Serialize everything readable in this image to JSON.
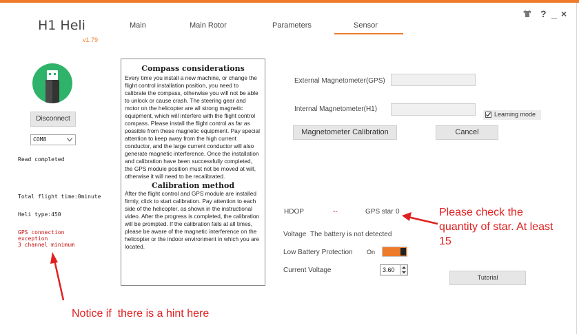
{
  "app": {
    "title": "H1 Heli",
    "version": "v1.79"
  },
  "tabs": [
    "Main",
    "Main Rotor",
    "Parameters",
    "Sensor"
  ],
  "window_controls": {
    "shirt": "shirt-icon",
    "help": "?",
    "minimize": "_",
    "close": "×"
  },
  "sidebar": {
    "disconnect_label": "Disconnect",
    "port_value": "COM8",
    "status_text": "Read completed",
    "flight_time": "Total flight time:0minute",
    "heli_type": "Heli type:450",
    "gps_error_line1": "GPS connection",
    "gps_error_line2": "exception",
    "gps_error_line3": "3 channel minimum"
  },
  "notes": {
    "compass_title": "Compass considerations",
    "compass_text": "Every time you install a new machine, or change the flight control installation position, you need to calibrate the compass, otherwise you will not be able to unlock or cause crash. The steering gear and motor on the helicopter are all strong magnetic equipment, which will interfere with the flight control compass. Please install the flight control as far as possible from these magnetic equipment. Pay special attention to keep away from the high current conductor, and the large current conductor will also generate magnetic interference. Once the installation and calibration have been successfully completed, the GPS module position must not be moved at will, otherwise it will need to be recalibrated.",
    "calibration_title": "Calibration method",
    "calibration_text": "After the flight control and GPS module are installed firmly, click to start calibration. Pay attention to each side of the helicopter, as shown in the instructional video. After the progress is completed, the calibration will be prompted. If the calibration fails at all times, please be aware of the magnetic interference on the helicopter or the indoor environment in which you are located."
  },
  "sensor": {
    "external_mag_label": "External Magnetometer(GPS)",
    "internal_mag_label": "Internal Magnetometer(H1)",
    "learning_mode_label": "Learning mode",
    "calibration_button": "Magnetometer Calibration",
    "cancel_button": "Cancel",
    "hdop_label": "HDOP",
    "hdop_value": "--",
    "gps_star_label": "GPS star",
    "gps_star_value": "0",
    "voltage_label": "Voltage",
    "voltage_status": "The battery is not detected",
    "low_battery_label": "Low Battery Protection",
    "low_battery_state": "On",
    "current_voltage_label": "Current Voltage",
    "current_voltage_value": "3.60",
    "tutorial_button": "Tutorial"
  },
  "annotations": {
    "star_note_line1": "Please check the",
    "star_note_line2": "quantity of star. At least",
    "star_note_line3": "15",
    "hint_note": "Notice if  there is a hint here"
  },
  "colors": {
    "accent": "#ee7b2a",
    "annotation": "#e02020",
    "usb_icon": "#2fb36b",
    "error_text": "#c41010"
  }
}
